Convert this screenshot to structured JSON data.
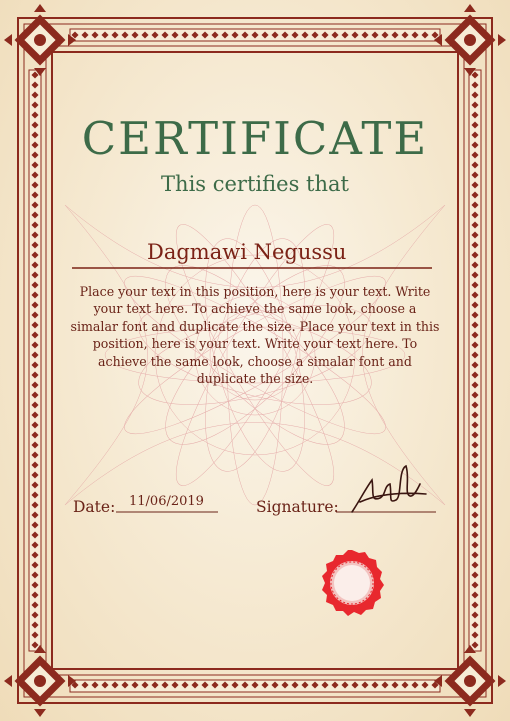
{
  "certificate": {
    "title": "CERTIFICATE",
    "subtitle": "This certifies that",
    "recipient_name": "Dagmawi Negussu",
    "body_text": "Place your text in this position, here is your text. Write your text here. To achieve the same look, choose a simalar font and duplicate the size. Place your text in this position, here is your text. Write your text here. To achieve the same look, choose a simalar font and duplicate the size.",
    "date_label": "Date:",
    "date_value": "11/06/2019",
    "signature_label": "Signature:"
  },
  "colors": {
    "border": "#8c2a1e",
    "title_green": "#3d6b48",
    "text_brown": "#6a2318",
    "seal_red": "#e8282e"
  }
}
